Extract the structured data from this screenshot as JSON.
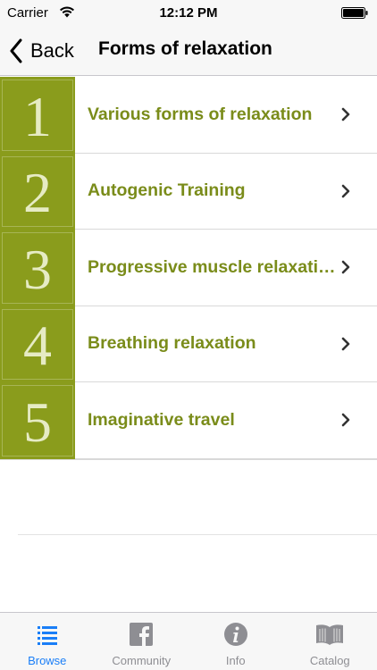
{
  "status_bar": {
    "carrier": "Carrier",
    "time": "12:12 PM"
  },
  "nav": {
    "back_label": "Back",
    "title": "Forms of relaxation"
  },
  "items": [
    {
      "number": "1",
      "title": "Various forms of relaxation"
    },
    {
      "number": "2",
      "title": "Autogenic Training"
    },
    {
      "number": "3",
      "title": "Progressive muscle relaxation"
    },
    {
      "number": "4",
      "title": "Breathing relaxation"
    },
    {
      "number": "5",
      "title": "Imaginative travel"
    }
  ],
  "tabs": [
    {
      "label": "Browse",
      "icon": "list-icon",
      "active": true
    },
    {
      "label": "Community",
      "icon": "facebook-icon",
      "active": false
    },
    {
      "label": "Info",
      "icon": "info-icon",
      "active": false
    },
    {
      "label": "Catalog",
      "icon": "book-icon",
      "active": false
    }
  ],
  "colors": {
    "accent_green": "#8a9c1c",
    "title_green": "#7a8c1a",
    "tab_active": "#1a7ef7",
    "tab_inactive": "#8e8e93"
  }
}
